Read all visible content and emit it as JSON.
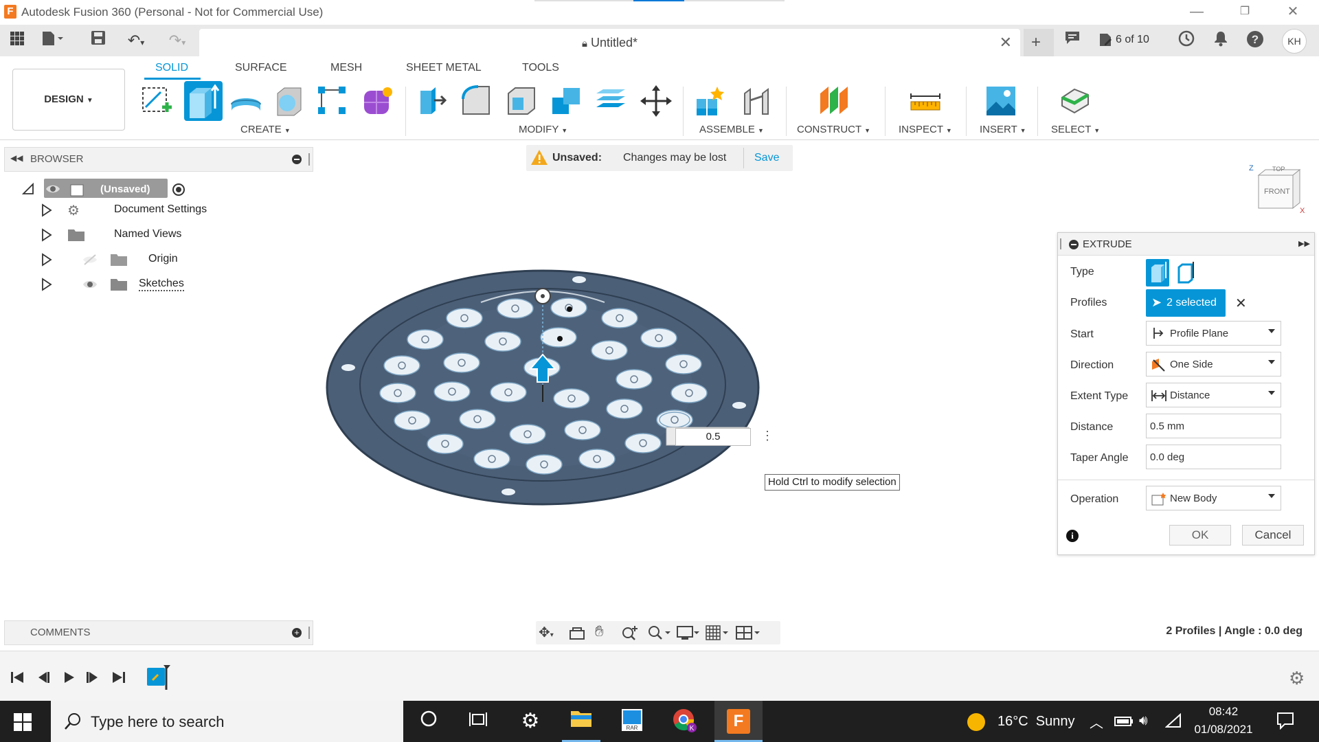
{
  "window": {
    "title": "Autodesk Fusion 360 (Personal - Not for Commercial Use)",
    "app_icon_letter": "F"
  },
  "tabbar": {
    "doc_title": "Untitled*",
    "job_status": "6 of 10",
    "user_initials": "KH"
  },
  "toolbar": {
    "workspace": "DESIGN",
    "tabs": [
      "SOLID",
      "SURFACE",
      "MESH",
      "SHEET METAL",
      "TOOLS"
    ],
    "groups": {
      "create": "CREATE",
      "modify": "MODIFY",
      "assemble": "ASSEMBLE",
      "construct": "CONSTRUCT",
      "inspect": "INSPECT",
      "insert": "INSERT",
      "select": "SELECT"
    }
  },
  "browser": {
    "title": "BROWSER",
    "root": "(Unsaved)",
    "items": [
      "Document Settings",
      "Named Views",
      "Origin",
      "Sketches"
    ]
  },
  "notice": {
    "label": "Unsaved:",
    "message": "Changes may be lost",
    "action": "Save"
  },
  "viewcube": {
    "top": "TOP",
    "front": "FRONT",
    "axis_x": "X",
    "axis_z": "Z"
  },
  "viewport": {
    "distance_input": "0.5",
    "tooltip": "Hold Ctrl to modify selection"
  },
  "extrude": {
    "title": "EXTRUDE",
    "rows": {
      "type": "Type",
      "profiles": "Profiles",
      "start": "Start",
      "direction": "Direction",
      "extent_type": "Extent Type",
      "distance": "Distance",
      "taper_angle": "Taper Angle",
      "operation": "Operation"
    },
    "values": {
      "profiles": "2 selected",
      "start": "Profile Plane",
      "direction": "One Side",
      "extent_type": "Distance",
      "distance": "0.5 mm",
      "taper_angle": "0.0 deg",
      "operation": "New Body"
    },
    "ok": "OK",
    "cancel": "Cancel"
  },
  "comments": {
    "title": "COMMENTS"
  },
  "status": "2 Profiles | Angle : 0.0 deg",
  "taskbar": {
    "search_placeholder": "Type here to search",
    "weather": "16°C  Sunny",
    "time": "08:42",
    "date": "01/08/2021"
  }
}
